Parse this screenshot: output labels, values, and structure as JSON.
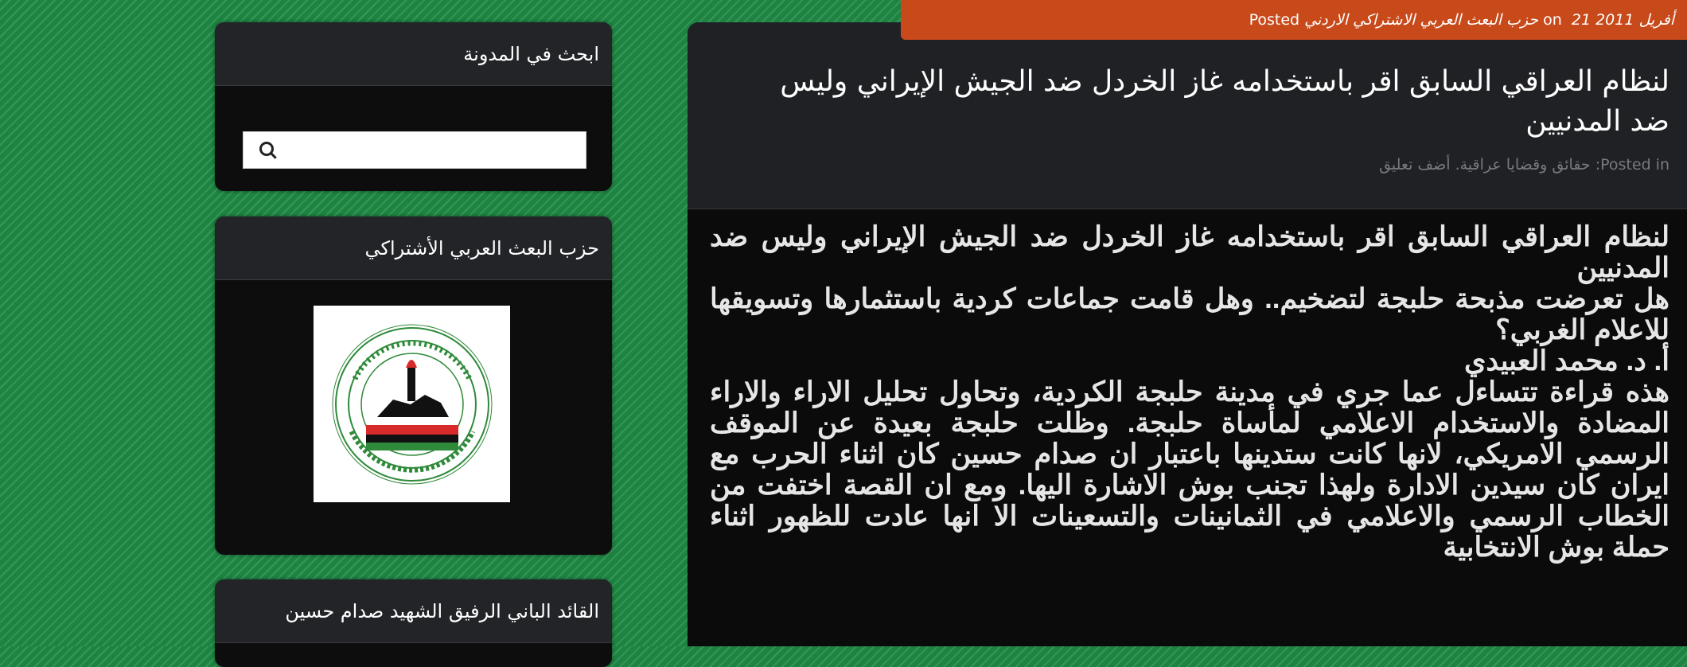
{
  "sidebar": {
    "search_widget": {
      "title": "ابحث في المدونة",
      "input_placeholder": ""
    },
    "party_widget": {
      "title": "حزب البعث العربي الأشتراكي"
    },
    "leader_widget": {
      "title": "القائد الباني الرفيق الشهيد صدام حسين"
    }
  },
  "post": {
    "badge": {
      "posted": "Posted",
      "author": "حزب البعث العربي الاشتراكي الاردني",
      "on": "on",
      "date": "21 أفريل 2011"
    },
    "title": "لنظام العراقي السابق اقر باستخدامه غاز الخردل ضد الجيش الإيراني وليس ضد المدنيين",
    "meta": {
      "posted_in": "Posted in",
      "categories": "حقائق وقضايا عراقية",
      "comment_link": "أضف تعليق"
    },
    "body": [
      "لنظام العراقي السابق اقر باستخدامه غاز الخردل ضد الجيش الإيراني وليس ضد المدنيين",
      "هل تعرضت مذبحة حلبجة لتضخيم.. وهل قامت جماعات كردية باستثمارها وتسويقها للاعلام الغربي؟",
      "أ. د. محمد العبيدي",
      "هذه قراءة تتساءل عما جري في مدينة حلبجة الكردية، وتحاول تحليل الاراء والاراء المضادة والاستخدام الاعلامي لمأساة حلبجة. وظلت حلبجة بعيدة عن الموقف الرسمي الامريكي، لانها كانت ستدينها باعتبار ان صدام حسين كان اثناء الحرب مع ايران كان سيدين الادارة ولهذا تجنب بوش الاشارة اليها. ومع ان القصة اختفت من الخطاب الرسمي والاعلامي في الثمانينات والتسعينات الا انها عادت للظهور اثناء حملة بوش الانتخابية"
    ]
  },
  "colors": {
    "background": "#1f8a45",
    "widget_header": "#232428",
    "widget_body": "#0d0d0d",
    "badge": "#c84a1a"
  }
}
